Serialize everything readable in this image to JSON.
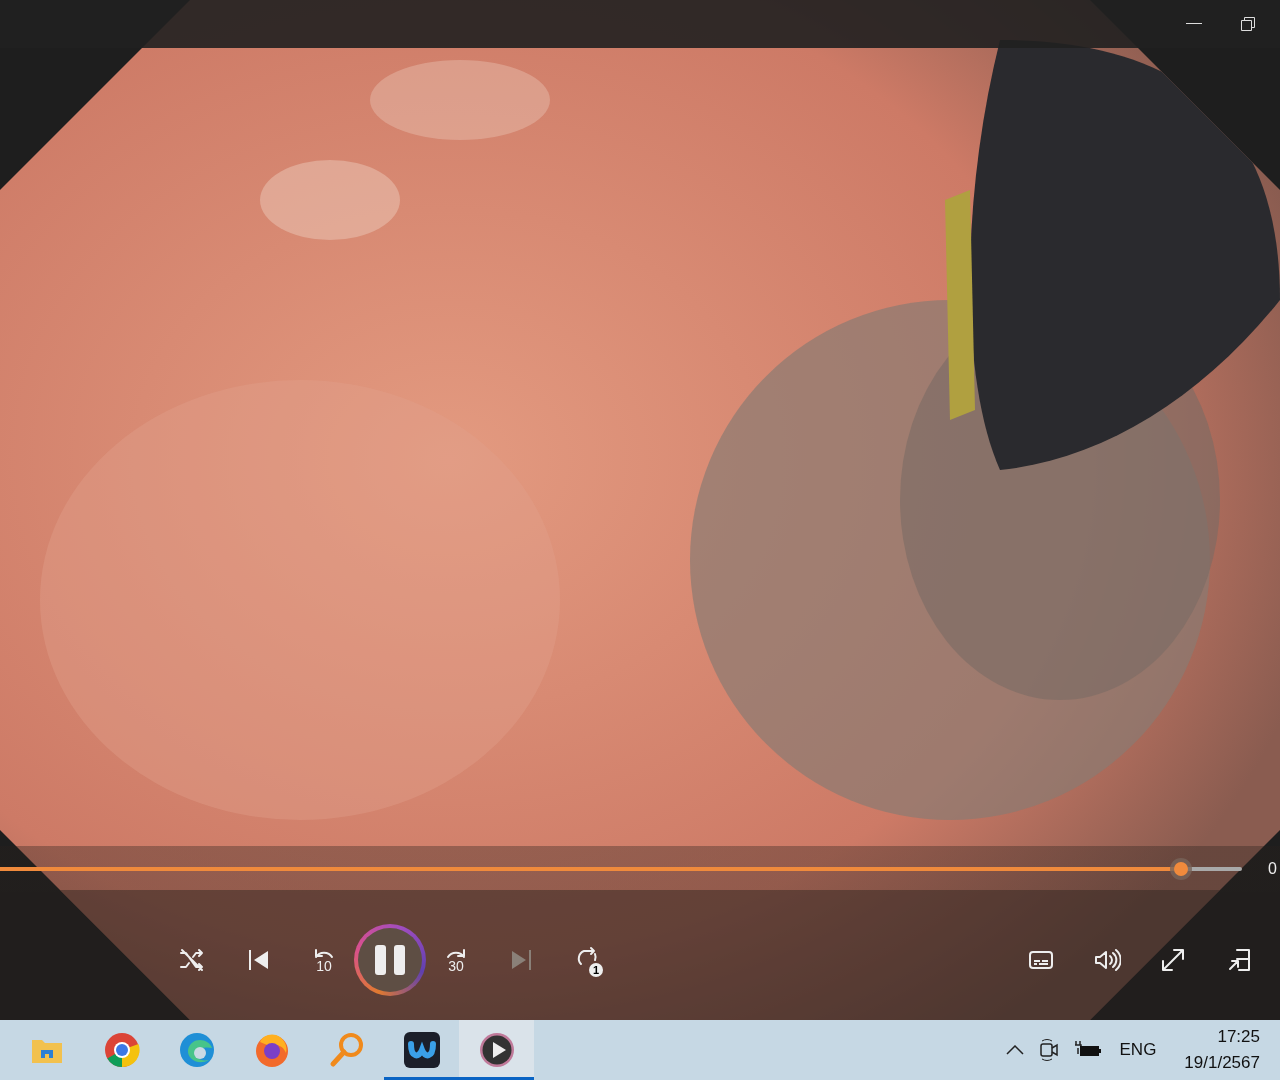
{
  "player": {
    "seek": {
      "level": 0.951,
      "time": "0"
    },
    "controls": [
      {
        "kind": "shuffle",
        "disabled": false
      },
      {
        "kind": "previous",
        "disabled": false
      },
      {
        "kind": "back",
        "label": "10",
        "disabled": false
      },
      {
        "kind": "play",
        "playing": true,
        "disabled": false
      },
      {
        "kind": "forward",
        "label": "30",
        "disabled": false
      },
      {
        "kind": "next",
        "disabled": true
      },
      {
        "kind": "repeat",
        "label": "1",
        "disabled": false
      }
    ],
    "right_controls": [
      {
        "kind": "captions"
      },
      {
        "kind": "volume"
      },
      {
        "kind": "fullscreen"
      },
      {
        "kind": "miniplayer"
      }
    ]
  },
  "taskbar": {
    "apps": [
      {
        "kind": "folder",
        "running": false,
        "selected": false
      },
      {
        "kind": "ring",
        "running": false,
        "selected": false
      },
      {
        "kind": "swirl",
        "running": false,
        "selected": false
      },
      {
        "kind": "flame",
        "running": false,
        "selected": false
      },
      {
        "kind": "magnifier",
        "running": false,
        "selected": false
      },
      {
        "kind": "tile",
        "running": true,
        "selected": false
      },
      {
        "kind": "play",
        "running": true,
        "selected": true
      }
    ],
    "tray": {
      "language": "ENG",
      "time": "17:25",
      "date": "19/1/2567"
    }
  }
}
